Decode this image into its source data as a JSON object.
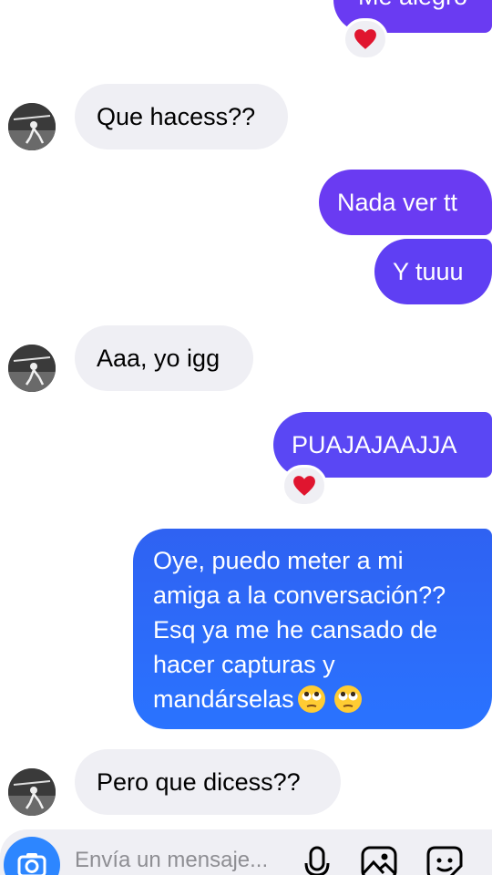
{
  "messages": {
    "m1": "Me alegro",
    "m2": "Que hacess??",
    "m3": "Nada ver tt",
    "m4": "Y tuuu",
    "m5": "Aaa, yo igg",
    "m6": "PUAJAJAAJJA",
    "m7_lines": [
      "Oye, puedo meter a mi",
      "amiga a la conversación??",
      "Esq ya me he cansado de",
      "hacer capturas y",
      "mandárselas"
    ],
    "m8": "Pero que dicess??"
  },
  "reactions": {
    "r1": "heart-icon",
    "r2": "heart-icon"
  },
  "emoji": [
    "eye-roll-emoji",
    "eye-roll-emoji"
  ],
  "composer": {
    "placeholder": "Envía un mensaje..."
  },
  "colors": {
    "outgoing_purple": "#6a3bf2",
    "outgoing_blue": "#2f6cf5",
    "incoming": "#efeff4",
    "camera": "#2d86ff",
    "heart": "#e0152f"
  }
}
